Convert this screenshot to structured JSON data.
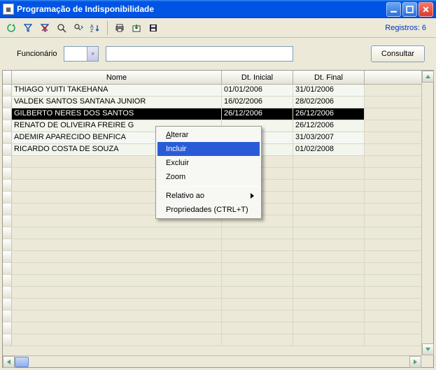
{
  "window": {
    "title": "Programação de Indisponibilidade"
  },
  "toolbar": {
    "record_count_label": "Registros: 6"
  },
  "filter": {
    "label": "Funcionário",
    "code_value": "",
    "desc_value": "",
    "consult_label": "Consultar"
  },
  "grid": {
    "headers": {
      "nome": "Nome",
      "inicial": "Dt. Inicial",
      "final": "Dt. Final"
    },
    "rows": [
      {
        "nome": "THIAGO YUITI TAKEHANA",
        "ini": "01/01/2006",
        "fin": "31/01/2006"
      },
      {
        "nome": "VALDEK SANTOS SANTANA JUNIOR",
        "ini": "16/02/2006",
        "fin": "28/02/2006"
      },
      {
        "nome": "GILBERTO NERES DOS SANTOS",
        "ini": "26/12/2006",
        "fin": "26/12/2006"
      },
      {
        "nome": "RENATO DE OLIVEIRA FREIRE G",
        "ini": "",
        "fin": "26/12/2006"
      },
      {
        "nome": "ADEMIR APARECIDO BENFICA",
        "ini": "",
        "fin": "31/03/2007"
      },
      {
        "nome": "RICARDO COSTA DE SOUZA",
        "ini": "",
        "fin": "01/02/2008"
      }
    ],
    "selected_index": 2
  },
  "context_menu": {
    "items": {
      "alterar": "Alterar",
      "incluir": "Incluir",
      "excluir": "Excluir",
      "zoom": "Zoom",
      "relativo": "Relativo ao",
      "propriedades": "Propriedades (CTRL+T)"
    },
    "highlighted": "incluir"
  }
}
